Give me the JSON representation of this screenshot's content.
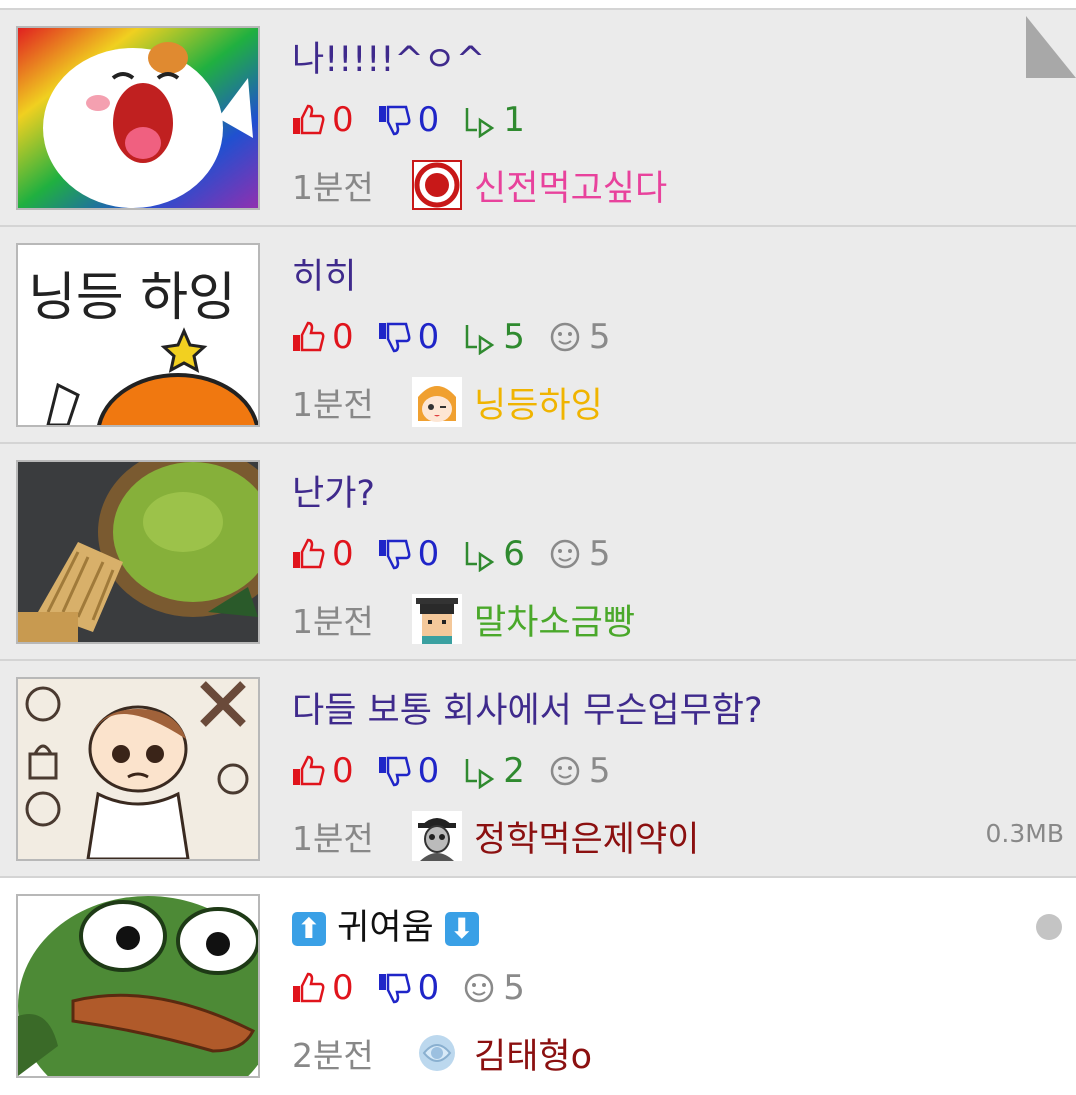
{
  "posts": [
    {
      "title": "나!!!!!^ㅇ^",
      "up": "0",
      "down": "0",
      "reply": "1",
      "views": "",
      "time": "1분전",
      "author": "신전먹고싶다",
      "author_color": "#e8429c",
      "size": ""
    },
    {
      "title": "히히",
      "up": "0",
      "down": "0",
      "reply": "5",
      "views": "5",
      "time": "1분전",
      "author": "닝등하잉",
      "author_color": "#f0b400",
      "size": ""
    },
    {
      "title": "난가?",
      "up": "0",
      "down": "0",
      "reply": "6",
      "views": "5",
      "time": "1분전",
      "author": "말차소금빵",
      "author_color": "#4aa82a",
      "size": ""
    },
    {
      "title": "다들 보통 회사에서 무슨업무함?",
      "up": "0",
      "down": "0",
      "reply": "2",
      "views": "5",
      "time": "1분전",
      "author": "정학먹은제약이",
      "author_color": "#8b1010",
      "size": "0.3MB"
    },
    {
      "title": "귀여움",
      "title_prefix": "⬆",
      "title_suffix": "⬇",
      "up": "0",
      "down": "0",
      "reply": "",
      "views": "5",
      "time": "2분전",
      "author": "김태형o",
      "author_color": "#8b1010",
      "size": ""
    }
  ],
  "icons": {
    "up": "thumbs-up-icon",
    "down": "thumbs-down-icon",
    "reply": "reply-arrow-icon",
    "views": "smiley-icon"
  },
  "colors": {
    "up": "#e0141c",
    "down": "#1f25c8",
    "reply": "#2f8a2f",
    "title": "#3f2a8c",
    "row_read": "#ebebeb"
  }
}
